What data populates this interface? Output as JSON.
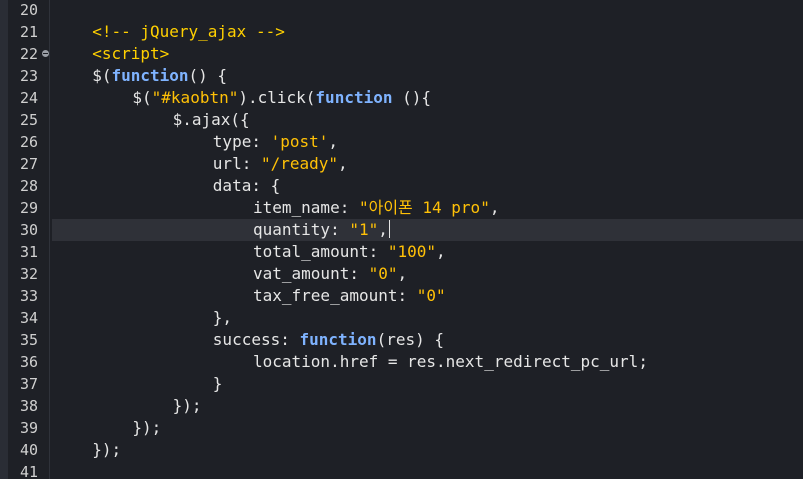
{
  "editor": {
    "lines": [
      {
        "num": "20",
        "indent": 0,
        "tokens": []
      },
      {
        "num": "21",
        "indent": 4,
        "tokens": [
          {
            "t": "comment",
            "v": "<!-- jQuery_ajax -->"
          }
        ]
      },
      {
        "num": "22",
        "indent": 4,
        "fold": true,
        "tokens": [
          {
            "t": "tag",
            "v": "<script>"
          }
        ]
      },
      {
        "num": "23",
        "indent": 4,
        "tokens": [
          {
            "t": "plain",
            "v": "$("
          },
          {
            "t": "kw",
            "v": "function"
          },
          {
            "t": "plain",
            "v": "() {"
          }
        ]
      },
      {
        "num": "24",
        "indent": 8,
        "tokens": [
          {
            "t": "plain",
            "v": "$("
          },
          {
            "t": "str",
            "v": "\"#kaobtn\""
          },
          {
            "t": "plain",
            "v": ").click("
          },
          {
            "t": "kw",
            "v": "function"
          },
          {
            "t": "plain",
            "v": " (){"
          }
        ]
      },
      {
        "num": "25",
        "indent": 12,
        "tokens": [
          {
            "t": "plain",
            "v": "$.ajax({"
          }
        ]
      },
      {
        "num": "26",
        "indent": 16,
        "tokens": [
          {
            "t": "plain",
            "v": "type: "
          },
          {
            "t": "str",
            "v": "'post'"
          },
          {
            "t": "plain",
            "v": ","
          }
        ]
      },
      {
        "num": "27",
        "indent": 16,
        "tokens": [
          {
            "t": "plain",
            "v": "url: "
          },
          {
            "t": "str",
            "v": "\"/ready\""
          },
          {
            "t": "plain",
            "v": ","
          }
        ]
      },
      {
        "num": "28",
        "indent": 16,
        "tokens": [
          {
            "t": "plain",
            "v": "data: {"
          }
        ]
      },
      {
        "num": "29",
        "indent": 20,
        "tokens": [
          {
            "t": "plain",
            "v": "item_name: "
          },
          {
            "t": "str",
            "v": "\"아이폰 14 pro\""
          },
          {
            "t": "plain",
            "v": ","
          }
        ]
      },
      {
        "num": "30",
        "indent": 20,
        "current": true,
        "caret": true,
        "tokens": [
          {
            "t": "plain",
            "v": "quantity: "
          },
          {
            "t": "str",
            "v": "\"1\""
          },
          {
            "t": "plain",
            "v": ","
          }
        ]
      },
      {
        "num": "31",
        "indent": 20,
        "tokens": [
          {
            "t": "plain",
            "v": "total_amount: "
          },
          {
            "t": "str",
            "v": "\"100\""
          },
          {
            "t": "plain",
            "v": ","
          }
        ]
      },
      {
        "num": "32",
        "indent": 20,
        "tokens": [
          {
            "t": "plain",
            "v": "vat_amount: "
          },
          {
            "t": "str",
            "v": "\"0\""
          },
          {
            "t": "plain",
            "v": ","
          }
        ]
      },
      {
        "num": "33",
        "indent": 20,
        "tokens": [
          {
            "t": "plain",
            "v": "tax_free_amount: "
          },
          {
            "t": "str",
            "v": "\"0\""
          }
        ]
      },
      {
        "num": "34",
        "indent": 16,
        "tokens": [
          {
            "t": "plain",
            "v": "},"
          }
        ]
      },
      {
        "num": "35",
        "indent": 16,
        "tokens": [
          {
            "t": "plain",
            "v": "success: "
          },
          {
            "t": "kw",
            "v": "function"
          },
          {
            "t": "plain",
            "v": "(res) {"
          }
        ]
      },
      {
        "num": "36",
        "indent": 20,
        "tokens": [
          {
            "t": "plain",
            "v": "location.href = res.next_redirect_pc_url;"
          }
        ]
      },
      {
        "num": "37",
        "indent": 16,
        "tokens": [
          {
            "t": "plain",
            "v": "}"
          }
        ]
      },
      {
        "num": "38",
        "indent": 12,
        "tokens": [
          {
            "t": "plain",
            "v": "});"
          }
        ]
      },
      {
        "num": "39",
        "indent": 8,
        "tokens": [
          {
            "t": "plain",
            "v": "});"
          }
        ]
      },
      {
        "num": "40",
        "indent": 4,
        "tokens": [
          {
            "t": "plain",
            "v": "});"
          }
        ]
      },
      {
        "num": "41",
        "indent": 0,
        "tokens": []
      }
    ]
  }
}
